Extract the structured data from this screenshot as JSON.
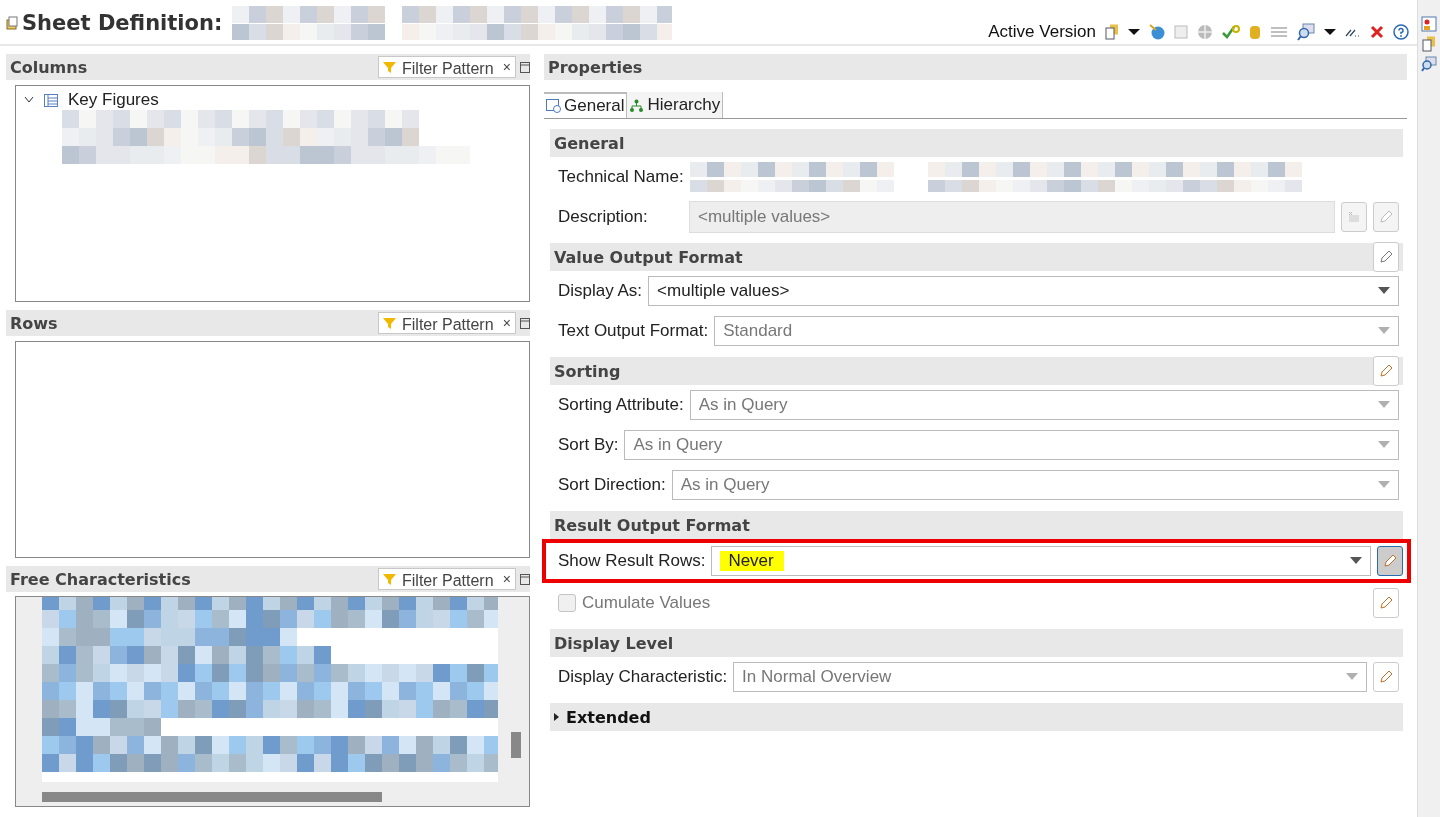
{
  "title": "Sheet Definition:",
  "toolbar": {
    "label": "Active Version"
  },
  "panels": [
    {
      "kind": "tree",
      "title": "Columns",
      "filter": {
        "placeholder": "Filter Pattern",
        "clear": "×"
      },
      "tree": [
        {
          "label": "Key Figures",
          "expanded": true
        }
      ]
    },
    {
      "kind": "empty",
      "title": "Rows",
      "filter": {
        "placeholder": "Filter Pattern",
        "clear": "×"
      }
    },
    {
      "kind": "redacted",
      "title": "Free Characteristics",
      "filter": {
        "placeholder": "Filter Pattern",
        "clear": "×"
      }
    }
  ],
  "properties": {
    "title": "Properties",
    "tabs": [
      {
        "label": "General",
        "selected": true
      },
      {
        "label": "Hierarchy",
        "selected": false
      }
    ],
    "sections": [
      {
        "title": "General",
        "expanded": true,
        "rows": [
          {
            "kind": "redacted",
            "label": "Technical Name:"
          },
          {
            "kind": "field",
            "label": "Description:",
            "value": "<multiple values>",
            "disabled": true
          }
        ]
      },
      {
        "title": "Value Output Format",
        "expanded": true,
        "rows": [
          {
            "kind": "select",
            "label": "Display As:",
            "value": "<multiple values>",
            "disabled": false,
            "highlighted": false
          },
          {
            "kind": "select",
            "label": "Text Output Format:",
            "value": "Standard",
            "disabled": true,
            "highlighted": false
          }
        ]
      },
      {
        "title": "Sorting",
        "expanded": true,
        "rows": [
          {
            "kind": "select",
            "label": "Sorting Attribute:",
            "value": "As in Query",
            "disabled": true,
            "highlighted": false
          },
          {
            "kind": "select",
            "label": "Sort By:",
            "value": "As in Query",
            "disabled": true,
            "highlighted": false
          },
          {
            "kind": "select",
            "label": "Sort Direction:",
            "value": "As in Query",
            "disabled": true,
            "highlighted": false
          }
        ]
      },
      {
        "title": "Result Output Format",
        "expanded": true,
        "rows": [
          {
            "kind": "select",
            "label": "Show Result Rows:",
            "value": "Never",
            "disabled": false,
            "highlighted": true
          },
          {
            "kind": "checkbox",
            "label": "Cumulate Values",
            "checked": false,
            "disabled": true
          }
        ]
      },
      {
        "title": "Display Level",
        "expanded": true,
        "rows": [
          {
            "kind": "select",
            "label": "Display Characteristic:",
            "value": "In Normal Overview",
            "disabled": true,
            "highlighted": false
          }
        ]
      },
      {
        "title": "Extended",
        "expanded": false
      }
    ]
  }
}
